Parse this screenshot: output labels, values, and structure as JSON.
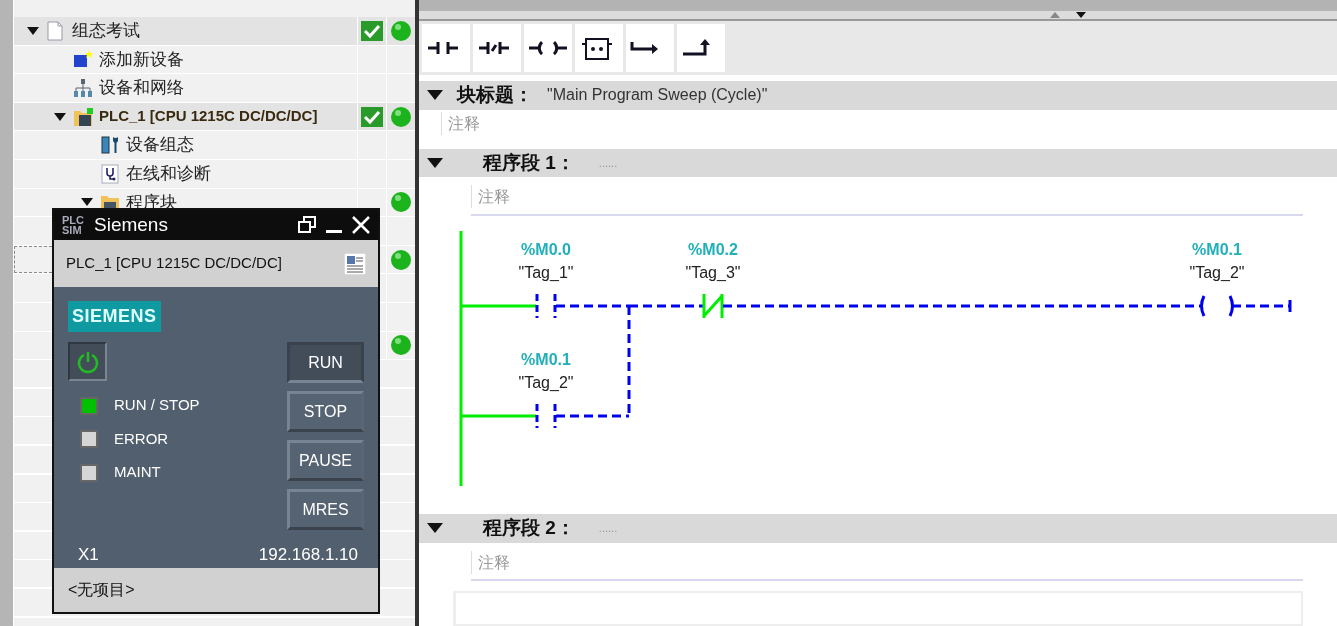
{
  "project_tree": {
    "items": [
      {
        "label": "组态考试",
        "kind": "project",
        "expanded": true,
        "compiled": true,
        "online": true,
        "selected": false,
        "children": [
          {
            "label": "添加新设备",
            "kind": "add",
            "selected": false
          },
          {
            "label": "设备和网络",
            "kind": "network",
            "selected": false
          },
          {
            "label": "PLC_1 [CPU 1215C DC/DC/DC]",
            "kind": "device",
            "expanded": true,
            "compiled": true,
            "online": true,
            "selected": false,
            "children": [
              {
                "label": "设备组态",
                "kind": "config",
                "selected": false
              },
              {
                "label": "在线和诊断",
                "kind": "diagnostics",
                "selected": false
              },
              {
                "label": "程序块",
                "kind": "folder",
                "expanded": true,
                "online": true,
                "selected": false,
                "children": [
                  {
                    "selected": false
                  },
                  {
                    "online": true,
                    "selected": true
                  },
                  {
                    "selected": false
                  },
                  {
                    "selected": false
                  },
                  {
                    "online": true,
                    "selected": false
                  }
                ]
              }
            ]
          }
        ]
      }
    ]
  },
  "editor": {
    "toolbar": [
      {
        "kind": "no_contact"
      },
      {
        "kind": "nc_contact"
      },
      {
        "kind": "coil"
      },
      {
        "kind": "box"
      },
      {
        "kind": "open_branch"
      },
      {
        "kind": "close_branch"
      }
    ],
    "block_title": {
      "label": "块标题：",
      "value": "\"Main Program Sweep (Cycle)\"",
      "comment": "注释"
    },
    "networks": [
      {
        "title": "程序段 1：",
        "note": "......",
        "comment": "注释",
        "rungs": [
          {
            "elements": [
              {
                "kind": "no_contact",
                "address": "%M0.0",
                "tag": "\"Tag_1\"",
                "closed": false
              },
              {
                "kind": "nc_contact",
                "address": "%M0.2",
                "tag": "\"Tag_3\"",
                "closed": true
              },
              {
                "kind": "coil",
                "address": "%M0.1",
                "tag": "\"Tag_2\"",
                "closed": false
              }
            ]
          },
          {
            "elements": [
              {
                "kind": "no_contact",
                "address": "%M0.1",
                "tag": "\"Tag_2\"",
                "closed": false
              }
            ]
          }
        ]
      },
      {
        "title": "程序段 2：",
        "note": "......",
        "comment": "注释"
      }
    ]
  },
  "plcsim": {
    "logo_top": "PLC",
    "logo_bottom": "SIM",
    "title": "Siemens",
    "device": "PLC_1 [CPU 1215C DC/DC/DC]",
    "brand": "SIEMENS",
    "power_on": true,
    "leds": [
      {
        "label": "RUN / STOP",
        "on": true
      },
      {
        "label": "ERROR",
        "on": false
      },
      {
        "label": "MAINT",
        "on": false
      }
    ],
    "buttons": [
      {
        "label": "RUN",
        "pressed": true
      },
      {
        "label": "STOP",
        "pressed": false
      },
      {
        "label": "PAUSE",
        "pressed": false
      },
      {
        "label": "MRES",
        "pressed": false
      }
    ],
    "port": "X1",
    "ip": "192.168.1.10",
    "project": "<无项目>"
  }
}
